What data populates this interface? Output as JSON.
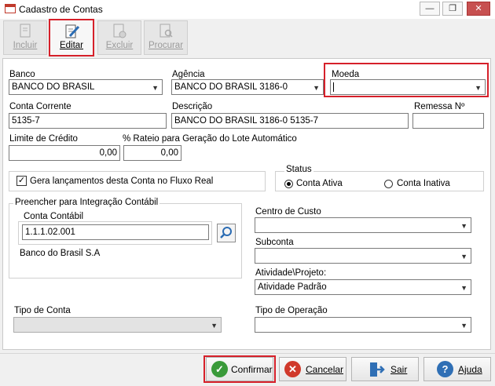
{
  "window": {
    "title": "Cadastro de Contas"
  },
  "toolbar": {
    "incluir": "Incluir",
    "editar": "Editar",
    "excluir": "Excluir",
    "procurar": "Procurar"
  },
  "form": {
    "banco": {
      "label": "Banco",
      "value": "BANCO DO BRASIL"
    },
    "agencia": {
      "label": "Agência",
      "value": "BANCO DO BRASIL 3186-0"
    },
    "moeda": {
      "label": "Moeda",
      "value": ""
    },
    "conta_corrente": {
      "label": "Conta Corrente",
      "value": "5135-7"
    },
    "descricao": {
      "label": "Descrição",
      "value": "BANCO DO BRASIL 3186-0 5135-7"
    },
    "remessa": {
      "label": "Remessa Nº",
      "value": ""
    },
    "limite_credito": {
      "label": "Limite de Crédito",
      "value": "0,00"
    },
    "rateio": {
      "label": "% Rateio para Geração do Lote Automático",
      "value": "0,00"
    },
    "fluxo_real": {
      "label": "Gera lançamentos desta Conta no Fluxo Real",
      "checked": "✓"
    },
    "status": {
      "label": "Status",
      "ativa": "Conta Ativa",
      "inativa": "Conta Inativa"
    },
    "integracao": {
      "label": "Preencher para Integração Contábil",
      "conta_contabil_label": "Conta Contábil",
      "conta_contabil_value": "1.1.1.02.001",
      "conta_contabil_desc": "Banco do Brasil S.A"
    },
    "centro_custo": {
      "label": "Centro de Custo",
      "value": ""
    },
    "subconta": {
      "label": "Subconta",
      "value": ""
    },
    "atividade": {
      "label": "Atividade\\Projeto:",
      "value": "Atividade Padrão"
    },
    "tipo_conta": {
      "label": "Tipo de Conta",
      "value": ""
    },
    "tipo_operacao": {
      "label": "Tipo de Operação",
      "value": ""
    }
  },
  "buttons": {
    "confirmar": "Confirmar",
    "cancelar": "Cancelar",
    "sair": "Sair",
    "ajuda": "Ajuda"
  },
  "colors": {
    "highlight": "#d6202a",
    "confirm": "#3a9a3a",
    "cancel": "#d0392b",
    "help": "#2f6fb5"
  }
}
